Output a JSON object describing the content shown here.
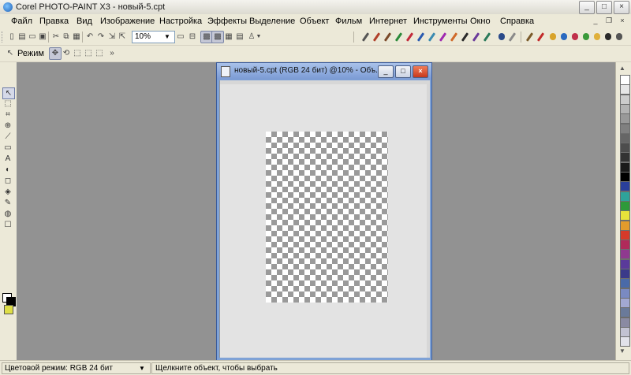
{
  "window": {
    "title": "Corel PHOTO-PAINT X3 - новый-5.cpt",
    "controls": {
      "minimize": "_",
      "maximize": "□",
      "close": "×"
    }
  },
  "menu": {
    "items": [
      "Файл",
      "Правка",
      "Вид",
      "Изображение",
      "Настройка",
      "Эффекты",
      "Выделение",
      "Объект",
      "Фильм",
      "Интернет",
      "Инструменты",
      "Окно",
      "Справка"
    ],
    "mdi_controls": {
      "minimize": "_",
      "restore": "❐",
      "close": "×"
    }
  },
  "toolbar": {
    "zoom_value": "10%",
    "mode_label": "Режим"
  },
  "document": {
    "title": "новый-5.cpt (RGB 24 бит) @10% - Объ...",
    "controls": {
      "minimize": "_",
      "maximize": "□",
      "close": "×"
    }
  },
  "toolbox": {
    "fill_color": "#dede46"
  },
  "palette": {
    "colors": [
      "#ffffff",
      "#e6e6e6",
      "#cccccc",
      "#b3b3b3",
      "#999999",
      "#808080",
      "#666666",
      "#4d4d4d",
      "#333333",
      "#1a1a1a",
      "#000000",
      "#2a3f9a",
      "#2fa39a",
      "#2e9a3a",
      "#e6e23a",
      "#e39b2c",
      "#d63a2a",
      "#b02a5a",
      "#8f3a8f",
      "#5a3a9a",
      "#3a3a8a",
      "#4a6aa8",
      "#7a8ac2",
      "#a2a8d2",
      "#6a7a9a",
      "#8a8aa2",
      "#c2c2d2",
      "#e2e2ea"
    ]
  },
  "status": {
    "color_mode": "Цветовой режим: RGB 24 бит",
    "hint": "Щелкните объект, чтобы выбрать"
  }
}
